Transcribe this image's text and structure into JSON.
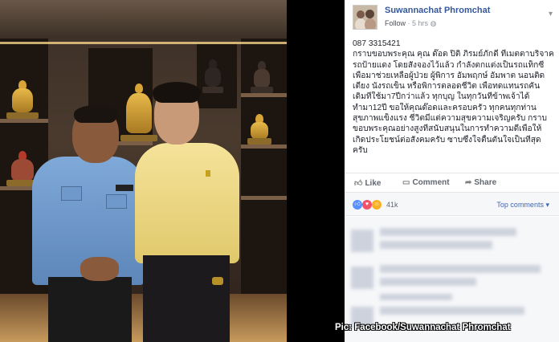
{
  "post": {
    "author": "Suwannachat Phromchat",
    "follow_label": "Follow",
    "time": "5 hrs",
    "lines": [
      "087 3315421",
      "กราบขอบพระคุณ คุณ ด๊อด ปิติ ภิรมย์ภักดี ที่เมตตาบริจาค",
      "รถป้ายแดง โดยสั่งจองไว้แล้ว กำลังตกแต่งเป็นรถแท็กซี่",
      "เพื่อมาช่วยเหลือผู้ป่วย ผู้พิการ อัมพฤกษ์ อัมพาต นอนติด",
      "เตียง นั่งรถเข็น หรือพิการตลอดชีวิต เพื่อทดแทนรถคัน",
      "เดิมที่ใช้มา7ปีกว่าแล้ว ทุกบุญ ในทุกวันที่ข้าพเจ้าได้",
      "ทำมา12ปี ขอให้คุณด๊อดและครอบครัว ทุกคนทุกท่าน",
      "สุขภาพแข็งแรง ชีวิตมีแต่ความสุขความเจริญครับ กราบ",
      "ขอบพระคุณอย่างสูงที่สนับสนุนในการทำความดีเพื่อให้",
      "เกิดประโยชน์ต่อสังคมครับ ซาบซึ้งใจตื้นตันใจเป็นที่สุด",
      "ครับ"
    ]
  },
  "actions": {
    "like": "Like",
    "comment": "Comment",
    "share": "Share"
  },
  "reactions": {
    "count": "41k",
    "sort_label": "Top comments"
  },
  "caption": "Pic: Facebook/Suwannachat Phromchat",
  "colors": {
    "link_blue": "#365899",
    "fb_blue": "#4267b2",
    "like_blue": "#5890ff",
    "love_red": "#f25268",
    "haha_yellow": "#f7b125"
  }
}
